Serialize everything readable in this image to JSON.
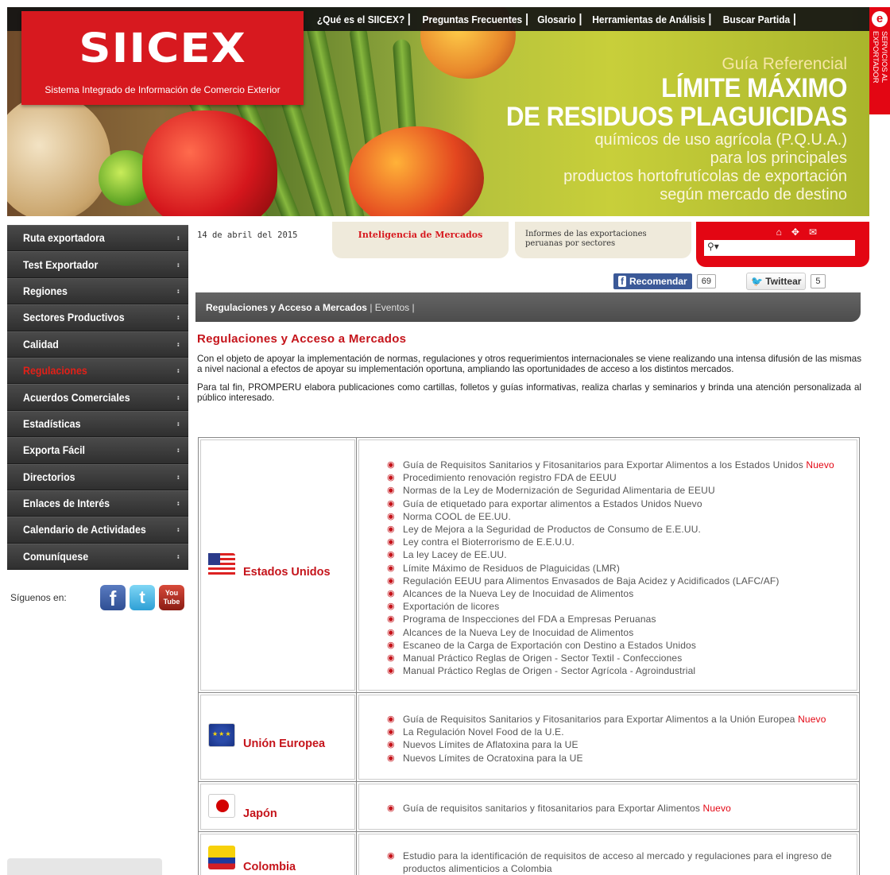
{
  "brand": {
    "logo": "SIICEX",
    "tagline": "Sistema Integrado de Información de Comercio Exterior"
  },
  "topnav": [
    "¿Qué es el SIICEX?",
    "Preguntas Frecuentes",
    "Glosario",
    "Herramientas de Análisis",
    "Buscar Partida"
  ],
  "banner": {
    "line1": "Guía Referencial",
    "line2": "LÍMITE MÁXIMO",
    "line3": "DE RESIDUOS PLAGUICIDAS",
    "line4": "químicos de uso agrícola (P.Q.U.A.)",
    "line5": "para los principales",
    "line6": "productos hortofrutícolas de exportación",
    "line7": "según mercado de destino"
  },
  "side_tab": {
    "icon": "e-logo-icon",
    "text": "SERVICIOS AL EXPORTADOR"
  },
  "sidebar": {
    "items": [
      "Ruta exportadora",
      "Test Exportador",
      "Regiones",
      "Sectores Productivos",
      "Calidad",
      "Regulaciones",
      "Acuerdos Comerciales",
      "Estadísticas",
      "Exporta Fácil",
      "Directorios",
      "Enlaces de Interés",
      "Calendario de Actividades",
      "Comuníquese"
    ],
    "active_index": 5,
    "follow_label": "Síguenos en:",
    "youtube_label_top": "You",
    "youtube_label_bottom": "Tube"
  },
  "info": {
    "date": "14 de abril del 2015",
    "tab_intel": "Inteligencia de Mercados",
    "tab_informes_1": "Informes de las exportaciones",
    "tab_informes_2": "peruanas por sectores",
    "search_placeholder": ""
  },
  "share": {
    "fb_label": "Recomendar",
    "fb_count": "69",
    "tw_label": "Twittear",
    "tw_count": "5"
  },
  "breadcrumb": {
    "current": "Regulaciones y Acceso a Mercados",
    "sep": " | ",
    "other": "Eventos",
    "tail": " |"
  },
  "content": {
    "title": "Regulaciones y Acceso a Mercados",
    "para1": "Con el objeto de apoyar la implementación de normas, regulaciones y otros requerimientos internacionales se viene realizando una intensa difusión de las mismas a nivel nacional a efectos de apoyar su implementación oportuna, ampliando las oportunidades de acceso a los distintos mercados.",
    "para2": "Para tal fin, PROMPERU elabora publicaciones como cartillas, folletos y guías informativas, realiza charlas y seminarios y brinda una atención personalizada al público interesado."
  },
  "new_label": "Nuevo",
  "countries": [
    {
      "name": "Estados Unidos",
      "links": [
        "Guía de Requisitos Sanitarios y Fitosanitarios para Exportar Alimentos a los Estados Unidos",
        "Procedimiento renovación registro FDA de EEUU",
        "Normas de la Ley de Modernización de Seguridad Alimentaria de EEUU",
        "Guía de etiquetado para exportar alimentos a Estados Unidos Nuevo",
        "Norma COOL de EE.UU.",
        "Ley de Mejora a la Seguridad de Productos de Consumo de E.E.UU.",
        "Ley contra el Bioterrorismo de E.E.U.U.",
        "La ley Lacey de EE.UU.",
        "Límite Máximo de Residuos de Plaguicidas (LMR)",
        "Regulación EEUU para Alimentos Envasados de Baja Acidez y Acidificados (LAFC/AF)",
        "Alcances de la Nueva Ley de Inocuidad de Alimentos",
        "Exportación de licores",
        "Programa de Inspecciones del FDA a Empresas Peruanas",
        "Alcances de la Nueva Ley de Inocuidad de Alimentos",
        "Escaneo de la Carga de Exportación con Destino a Estados Unidos",
        "Manual Práctico Reglas de Origen - Sector Textil - Confecciones",
        "Manual Práctico Reglas de Origen - Sector Agrícola - Agroindustrial"
      ]
    },
    {
      "name": "Unión Europea",
      "links": [
        "Guía de Requisitos Sanitarios y Fitosanitarios para Exportar Alimentos a la Unión Europea",
        "La Regulación Novel Food de la U.E.",
        "Nuevos Límites de Aflatoxina para la UE",
        "Nuevos Límites de Ocratoxina para la UE"
      ]
    },
    {
      "name": "Japón",
      "links": [
        "Guía de requisitos sanitarios y fitosanitarios para Exportar Alimentos"
      ]
    },
    {
      "name": "Colombia",
      "links": [
        "Estudio para la identificación de requisitos de acceso al mercado y regulaciones para el ingreso de productos alimenticios a Colombia"
      ]
    }
  ]
}
